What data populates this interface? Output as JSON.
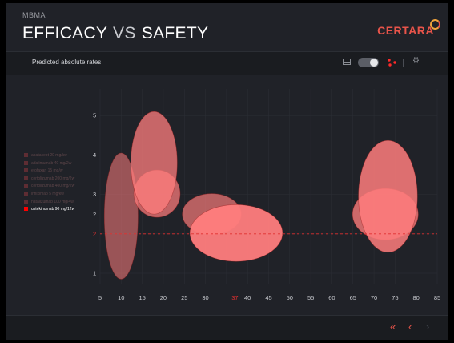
{
  "header": {
    "eyebrow": "MBMA",
    "title_left": "EFFICACY",
    "title_vs": "VS",
    "title_right": "SAFETY",
    "brand": "CERTARA"
  },
  "toolbar": {
    "subtitle": "Predicted absolute rates",
    "table_icon": "table-icon",
    "view_toggle_on": true,
    "scatter_icon": "scatter-icon",
    "settings_icon": "gear-icon"
  },
  "colors": {
    "background": "#202228",
    "accent": "#e8544a",
    "ellipse_fill": "#ff7d7d",
    "reference_line": "#e03030"
  },
  "legend": [
    {
      "label": "abatacept 20 mg/kw",
      "active": false
    },
    {
      "label": "adalimumab 40 mg/2w",
      "active": false
    },
    {
      "label": "etofaxan 15 mg/w",
      "active": false
    },
    {
      "label": "certolizumab 200 mg/2w",
      "active": false
    },
    {
      "label": "certolizumab 400 mg/2w",
      "active": false
    },
    {
      "label": "infliximab 5 mg/kw",
      "active": false
    },
    {
      "label": "natalizumab 100 mg/4w",
      "active": false
    },
    {
      "label": "ustekinumab 90 mg/12w",
      "active": true
    }
  ],
  "chart_data": {
    "type": "scatter",
    "x_ticks": [
      "5",
      "10",
      "15",
      "20",
      "25",
      "30",
      "37",
      "40",
      "45",
      "50",
      "55",
      "60",
      "65",
      "70",
      "75",
      "80",
      "85"
    ],
    "y_ticks": [
      "1",
      "2",
      "2",
      "3",
      "4",
      "5"
    ],
    "xlim": [
      5,
      85
    ],
    "ylim": [
      0.5,
      5.5
    ],
    "reference": {
      "x": 37,
      "y": 2
    },
    "ellipses": [
      {
        "cx": 10,
        "cy": 2.45,
        "rx": 4,
        "ry": 1.6,
        "opacity": 0.55
      },
      {
        "cx": 18.5,
        "cy": 3.02,
        "rx": 5.5,
        "ry": 0.6,
        "opacity": 0.72
      },
      {
        "cx": 17.8,
        "cy": 3.8,
        "rx": 5.5,
        "ry": 1.3,
        "opacity": 0.75
      },
      {
        "cx": 31.5,
        "cy": 2.5,
        "rx": 7,
        "ry": 0.52,
        "opacity": 0.68
      },
      {
        "cx": 37.3,
        "cy": 2.02,
        "rx": 11,
        "ry": 0.72,
        "opacity": 0.95
      },
      {
        "cx": 72.7,
        "cy": 2.5,
        "rx": 7.8,
        "ry": 0.65,
        "opacity": 0.78
      },
      {
        "cx": 73.3,
        "cy": 2.95,
        "rx": 7,
        "ry": 1.42,
        "opacity": 0.85
      }
    ]
  },
  "footer": {
    "first_page": "«",
    "prev_page": "‹",
    "next_page": "›"
  }
}
